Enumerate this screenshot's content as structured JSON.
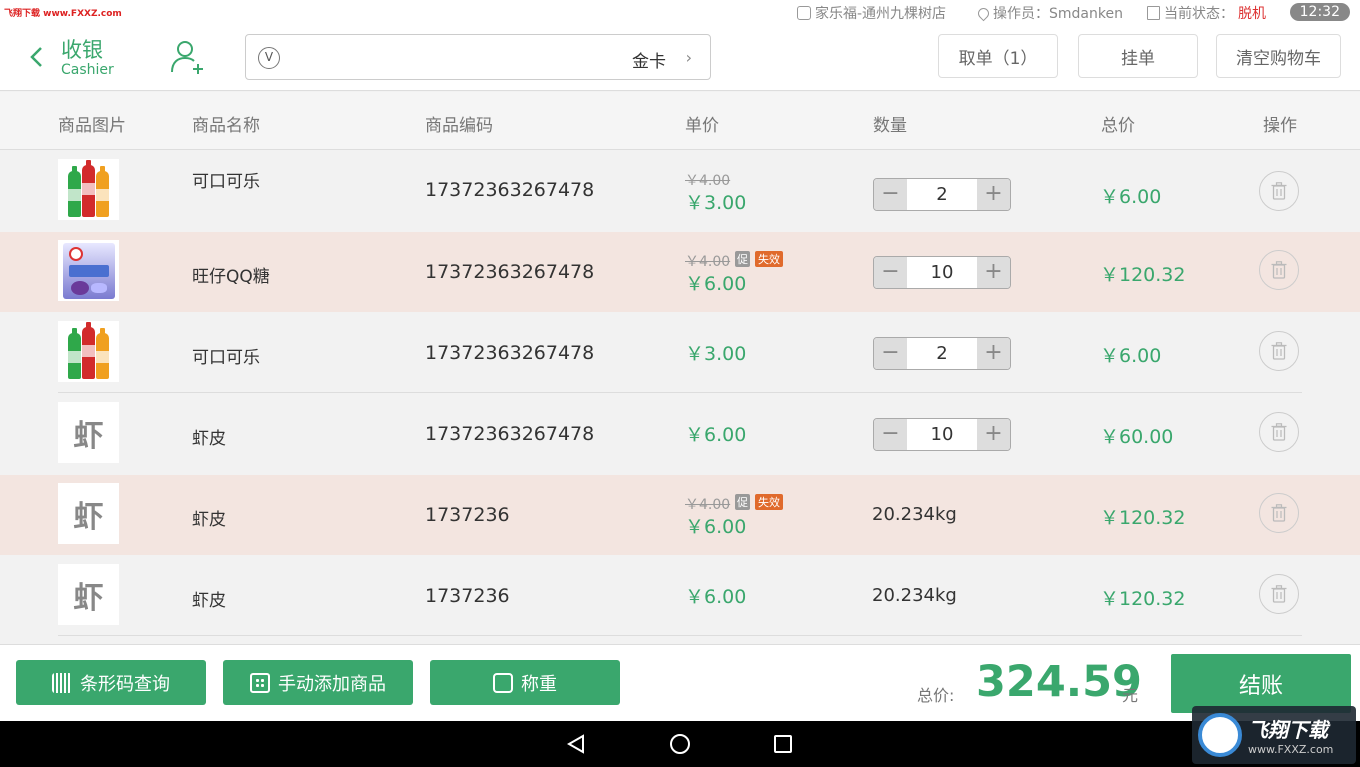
{
  "watermark_top": "飞翔下载 www.FXXZ.com",
  "status": {
    "store": "家乐福-通州九棵树店",
    "operator": "操作员：Smdanken",
    "state_label": "当前状态：",
    "state_value": "脱机",
    "time": "12:32"
  },
  "header": {
    "title_cn": "收银",
    "title_en": "Cashier",
    "member_card": "金卡",
    "vip_icon_text": "V",
    "btn_take_order": "取单（1）",
    "btn_hold_order": "挂单",
    "btn_clear_cart": "清空购物车"
  },
  "table": {
    "columns": [
      "商品图片",
      "商品名称",
      "商品编码",
      "单价",
      "数量",
      "总价",
      "操作"
    ],
    "rows": [
      {
        "image": "cola",
        "name": "可口可乐",
        "code": "17372363267478",
        "old_price": "￥4.00",
        "price": "￥3.00",
        "qty": "2",
        "total": "￥6.00",
        "promo": false,
        "tags": false,
        "type": "stepper"
      },
      {
        "image": "candy",
        "name": "旺仔QQ糖",
        "code": "17372363267478",
        "old_price": "￥4.00",
        "price": "￥6.00",
        "qty": "10",
        "total": "￥120.32",
        "promo": true,
        "tags": true,
        "type": "stepper"
      },
      {
        "image": "cola",
        "name": "可口可乐",
        "code": "17372363267478",
        "old_price": "",
        "price": "￥3.00",
        "qty": "2",
        "total": "￥6.00",
        "promo": false,
        "tags": false,
        "type": "stepper"
      },
      {
        "image": "placeholder",
        "placeholder": "虾",
        "name": "虾皮",
        "code": "17372363267478",
        "old_price": "",
        "price": "￥6.00",
        "qty": "10",
        "total": "￥60.00",
        "promo": false,
        "tags": false,
        "type": "stepper"
      },
      {
        "image": "placeholder",
        "placeholder": "虾",
        "name": "虾皮",
        "code": "1737236",
        "old_price": "￥4.00",
        "price": "￥6.00",
        "qty": "20.234kg",
        "total": "￥120.32",
        "promo": true,
        "tags": true,
        "type": "weight"
      },
      {
        "image": "placeholder",
        "placeholder": "虾",
        "name": "虾皮",
        "code": "1737236",
        "old_price": "",
        "price": "￥6.00",
        "qty": "20.234kg",
        "total": "￥120.32",
        "promo": false,
        "tags": false,
        "type": "weight"
      }
    ],
    "tag_promo": "促",
    "tag_expired": "失效"
  },
  "footer": {
    "btn_barcode": "条形码查询",
    "btn_manual_add": "手动添加商品",
    "btn_weigh": "称重",
    "total_label": "总价:",
    "total_amount": "324.59",
    "total_unit": "元",
    "btn_checkout": "结账"
  },
  "watermark_br": {
    "name": "飞翔下载",
    "url": "www.FXXZ.com"
  },
  "colors": {
    "accent": "#3aa76d",
    "promo_row": "#f3e5e0",
    "offline": "#dd3333",
    "expired_tag": "#e06a2c"
  }
}
